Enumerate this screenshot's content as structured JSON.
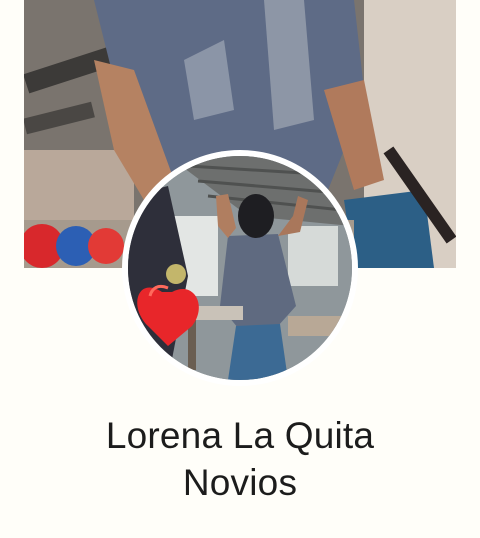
{
  "profile": {
    "name_line_1": "Lorena La Quita",
    "name_line_2": "Novios"
  },
  "colors": {
    "background": "#fffef9",
    "name_text": "#1c1c1c",
    "avatar_ring": "#ffffff",
    "heart_red": "#e8262a"
  }
}
